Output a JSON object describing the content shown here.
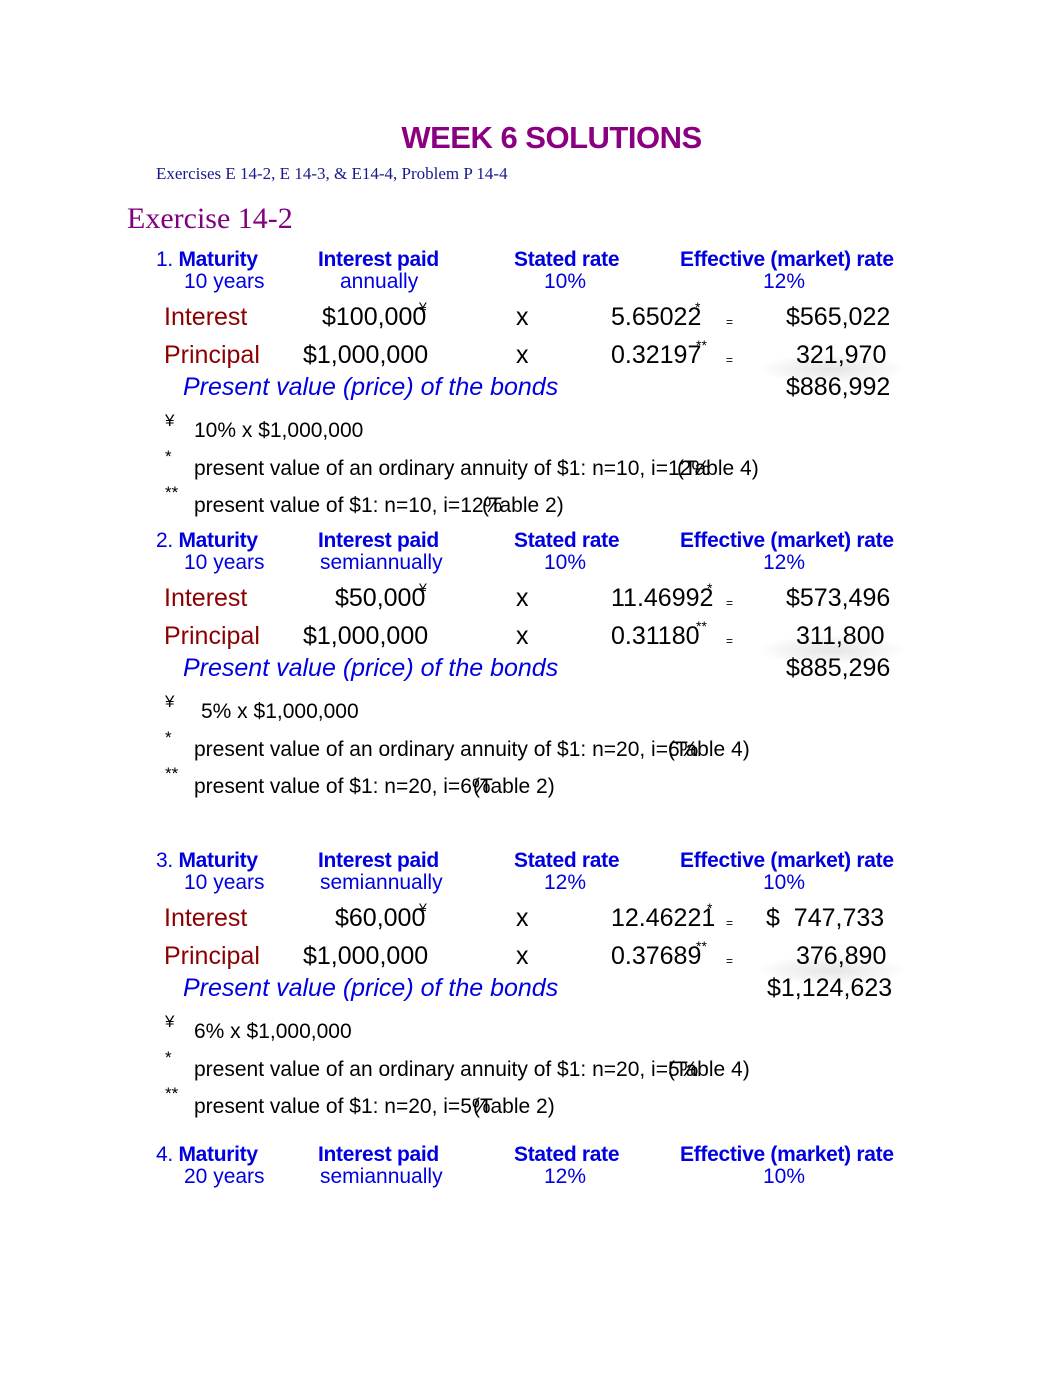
{
  "title": "WEEK 6 SOLUTIONS",
  "subtitle": "Exercises E 14-2, E 14-3, & E14-4, Problem P 14-4",
  "exercise_heading": "Exercise 14-2",
  "headers": {
    "maturity": "Maturity",
    "interest_paid": "Interest paid",
    "stated_rate": "Stated rate",
    "effective_rate": "Effective (market) rate"
  },
  "labels": {
    "interest": "Interest",
    "principal": "Principal",
    "pv": "Present value (price) of the bonds",
    "times": "x",
    "equals": "=",
    "yen": "¥",
    "star": "*",
    "dstar": "**"
  },
  "problems": [
    {
      "num": "1.",
      "maturity": "10 years",
      "interest_paid": "annually",
      "stated_rate": "10%",
      "effective_rate": "12%",
      "interest_amount": "$100,000",
      "interest_factor": "5.65022",
      "interest_result": "$565,022",
      "principal_amount": "$1,000,000",
      "principal_factor": "0.32197",
      "principal_result": "321,970",
      "pv_total": "$886,992",
      "fn_yen": "10% x $1,000,000",
      "fn_star": "present value of an ordinary annuity of $1: n=10, i=12%",
      "fn_star_table": "(Table 4)",
      "fn_dstar": "present value of $1: n=10, i=12%",
      "fn_dstar_table": "(Table 2)"
    },
    {
      "num": "2.",
      "maturity": "10 years",
      "interest_paid": "semiannually",
      "stated_rate": "10%",
      "effective_rate": "12%",
      "interest_amount": "$50,000",
      "interest_factor": "11.46992",
      "interest_result": "$573,496",
      "principal_amount": "$1,000,000",
      "principal_factor": "0.31180",
      "principal_result": "311,800",
      "pv_total": "$885,296",
      "fn_yen": "5% x $1,000,000",
      "fn_star": "present value of an ordinary annuity of $1: n=20, i=6%",
      "fn_star_table": "(Table 4)",
      "fn_dstar": "present value of $1: n=20, i=6%",
      "fn_dstar_table": "(Table 2)"
    },
    {
      "num": "3.",
      "maturity": "10 years",
      "interest_paid": "semiannually",
      "stated_rate": "12%",
      "effective_rate": "10%",
      "interest_amount": "$60,000",
      "interest_factor": "12.46221",
      "interest_result": "$  747,733",
      "principal_amount": "$1,000,000",
      "principal_factor": "0.37689",
      "principal_result": "376,890",
      "pv_total": "$1,124,623",
      "fn_yen": "6% x $1,000,000",
      "fn_star": "present value of an ordinary annuity of $1: n=20, i=5%",
      "fn_star_table": "(Table 4)",
      "fn_dstar": "present value of $1: n=20, i=5%",
      "fn_dstar_table": "(Table 2)"
    },
    {
      "num": "4.",
      "maturity": "20 years",
      "interest_paid": "semiannually",
      "stated_rate": "12%",
      "effective_rate": "10%"
    }
  ]
}
